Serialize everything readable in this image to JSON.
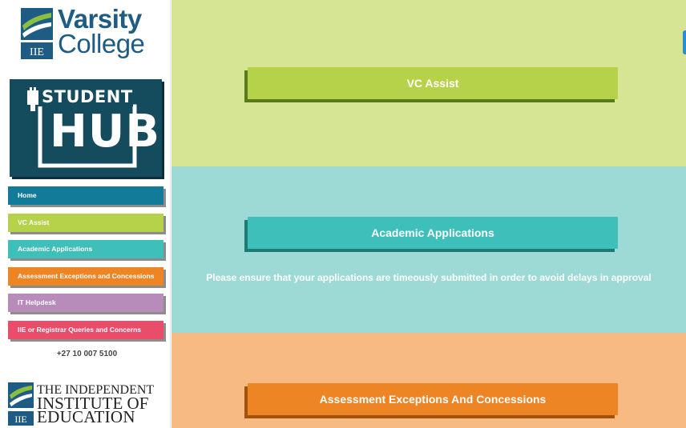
{
  "brand": {
    "vc_name_line1": "Varsity",
    "vc_name_line2": "College",
    "vc_badge": "IIE",
    "hub_word1": "STUDENT",
    "hub_word2": "HUB",
    "iie_line1": "THE INDEPENDENT",
    "iie_line2": "INSTITUTE OF",
    "iie_line3": "EDUCATION",
    "iie_badge": "IIE"
  },
  "colors": {
    "vc_blue": "#1f5c84",
    "vc_green": "#8bbf3f",
    "hub_bg": "#144b5d",
    "home": "#137b9a",
    "vc_assist": "#b6d24b",
    "academic": "#3fbfb9",
    "assessment": "#ee8525",
    "it_helpdesk": "#b78cbb",
    "registrar": "#e94d6a",
    "section_green": "#d5e593",
    "section_teal": "#9ddad6",
    "section_orange": "#f6ba82"
  },
  "sidebar": {
    "nav": [
      {
        "label": "Home",
        "icon": "none"
      },
      {
        "label": "VC Assist",
        "icon": "none"
      },
      {
        "label": "Academic Applications",
        "icon": "none"
      },
      {
        "label": "Assessment Exceptions and Concessions",
        "icon": "none"
      },
      {
        "label": "IT Helpdesk",
        "icon": "none"
      },
      {
        "label": "IIE or Registrar Queries and Concerns",
        "icon": "none"
      }
    ],
    "phone_icon": "phone-icon",
    "phone_glyph": "",
    "phone": "+27 10 007 5100"
  },
  "main": {
    "sections": [
      {
        "title": "VC Assist",
        "notice": ""
      },
      {
        "title": "Academic Applications",
        "notice": "Please ensure that your applications are timeously submitted in order to avoid delays in approval"
      },
      {
        "title": "Assessment Exceptions And Concessions",
        "notice": ""
      }
    ]
  }
}
